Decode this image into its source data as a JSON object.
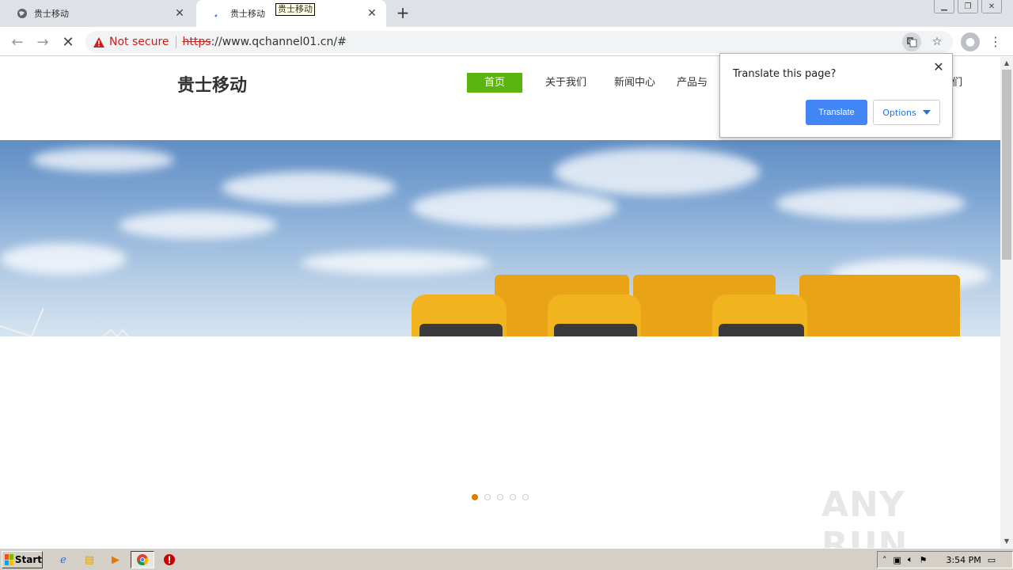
{
  "browser": {
    "tabs": [
      {
        "title": "贵士移动",
        "active": false
      },
      {
        "title": "贵士移动",
        "active": true
      }
    ],
    "tooltip": "贵士移动",
    "new_tab": "+",
    "security_label": "Not secure",
    "url_scheme": "https",
    "url_rest": "://www.qchannel01.cn/#"
  },
  "site": {
    "logo": "贵士移动",
    "nav": [
      "首页",
      "关于我们",
      "新闻中心",
      "产品与",
      "我们"
    ],
    "active_nav": 0,
    "carousel_active_index": 0,
    "carousel_count": 5
  },
  "translate_bubble": {
    "title": "Translate this page?",
    "translate_label": "Translate",
    "options_label": "Options"
  },
  "watermark": "ANY RUN",
  "taskbar": {
    "start_label": "Start",
    "clock": "3:54 PM"
  },
  "colors": {
    "nav_active": "#5cb50f",
    "translate_button": "#4285f4",
    "dot_active": "#e07b00",
    "not_secure": "#c5221f"
  }
}
